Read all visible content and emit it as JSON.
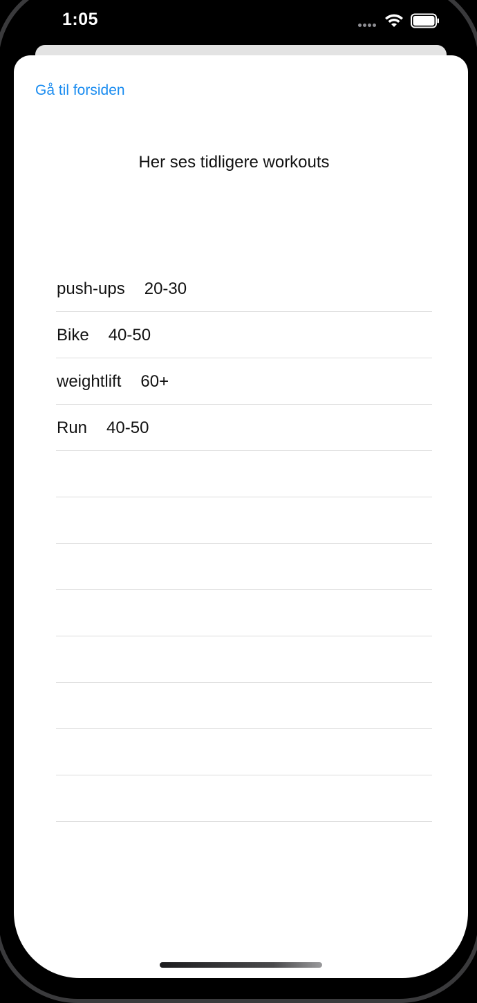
{
  "status_bar": {
    "time": "1:05"
  },
  "navigation": {
    "back_label": "Gå til forsiden"
  },
  "page": {
    "title": "Her ses tidligere workouts"
  },
  "workouts": [
    {
      "name": "push-ups",
      "range": "20-30"
    },
    {
      "name": "Bike",
      "range": "40-50"
    },
    {
      "name": "weightlift",
      "range": "60+"
    },
    {
      "name": "Run",
      "range": "40-50"
    },
    {
      "name": "",
      "range": ""
    },
    {
      "name": "",
      "range": ""
    },
    {
      "name": "",
      "range": ""
    },
    {
      "name": "",
      "range": ""
    },
    {
      "name": "",
      "range": ""
    },
    {
      "name": "",
      "range": ""
    },
    {
      "name": "",
      "range": ""
    },
    {
      "name": "",
      "range": ""
    }
  ],
  "colors": {
    "accent": "#1a8cf0",
    "background": "#000000",
    "sheet": "#ffffff",
    "separator": "#dcdcdc"
  },
  "icons": {
    "signal": "cellular-signal-icon",
    "wifi": "wifi-icon",
    "battery": "battery-icon"
  }
}
